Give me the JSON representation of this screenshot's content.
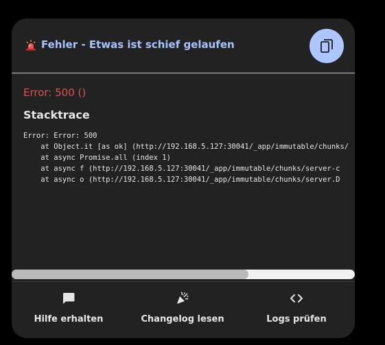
{
  "dialog": {
    "title": "Fehler - Etwas ist schief gelaufen",
    "title_icon": "siren-icon",
    "copy_icon": "copy-icon"
  },
  "error": {
    "code_text": "Error: 500 ()",
    "stack_heading": "Stacktrace",
    "stack_lines": [
      "Error: Error: 500",
      "    at Object.it [as ok] (http://192.168.5.127:30041/_app/immutable/chunks/",
      "    at async Promise.all (index 1)",
      "    at async f (http://192.168.5.127:30041/_app/immutable/chunks/server-c",
      "    at async o (http://192.168.5.127:30041/_app/immutable/chunks/server.D"
    ],
    "horizontal_scroll_fraction": 0.69
  },
  "footer": {
    "actions": [
      {
        "label": "Hilfe erhalten",
        "icon": "chat-bubble-icon"
      },
      {
        "label": "Changelog lesen",
        "icon": "party-popper-icon"
      },
      {
        "label": "Logs prüfen",
        "icon": "code-icon"
      }
    ]
  },
  "colors": {
    "card_background": "#222222",
    "title_color": "#a9c3ff",
    "accent_button": "#aec6ff",
    "error_red": "#e0524f"
  }
}
